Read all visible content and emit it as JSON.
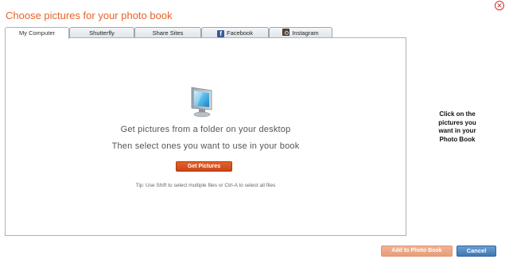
{
  "dialog": {
    "title": "Choose pictures for your photo book",
    "close_symbol": "✕"
  },
  "tabs": [
    {
      "label": "My Computer",
      "active": true
    },
    {
      "label": "Shutterfly",
      "active": false
    },
    {
      "label": "Share Sites",
      "active": false
    },
    {
      "label": "Facebook",
      "active": false,
      "icon": "facebook-icon"
    },
    {
      "label": "Instagram",
      "active": false,
      "icon": "instagram-icon"
    }
  ],
  "panel": {
    "icon": "monitor-icon",
    "line1": "Get pictures from a folder on your desktop",
    "line2": "Then select ones you want to use in your book",
    "button_label": "Get Pictures",
    "tip": "Tip: Use Shift to select multiple files or Ctrl-A to select all files"
  },
  "hint": {
    "line1": "Click on the",
    "line2": "pictures you",
    "line3": "want in your",
    "line4": "Photo Book"
  },
  "footer": {
    "add_label": "Add to Photo Book",
    "cancel_label": "Cancel"
  },
  "colors": {
    "accent": "#e8622b",
    "primary_button": "#3f77b3",
    "disabled_add": "#e89c78"
  }
}
